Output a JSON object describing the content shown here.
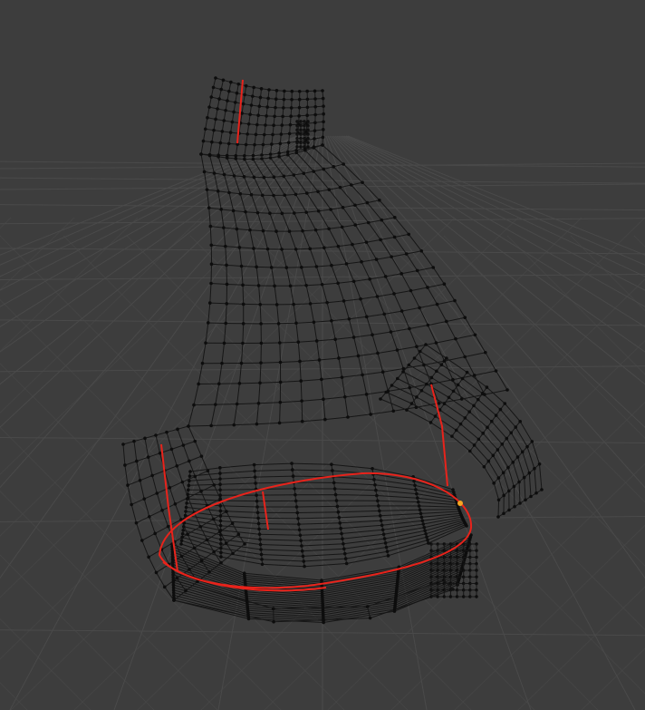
{
  "viewport": {
    "kind": "3D viewport - edit mode wireframe",
    "background_color": "#3d3d3d",
    "grid_color": "#4a4a4a",
    "wire_color": "#161616",
    "vertex_color": "#0d0d0d",
    "seam_color": "#e8231b",
    "active_vertex_color": "#f5a623",
    "grid_icon": "floor-grid",
    "show_grid": true
  }
}
